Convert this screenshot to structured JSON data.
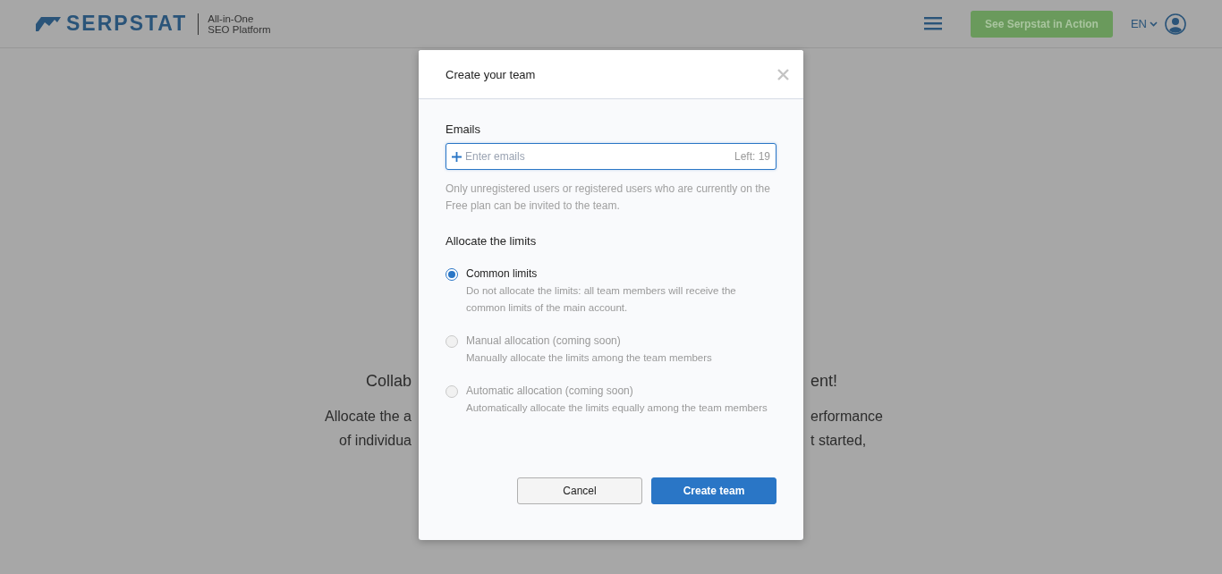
{
  "header": {
    "logo": {
      "name": "SERPSTAT",
      "tagline_line_1": "All-in-One",
      "tagline_line_2": "SEO Platform"
    },
    "cta_button": "See Serpstat in Action",
    "language": "EN"
  },
  "background": {
    "heading_left": "Collab",
    "heading_right": "ent!",
    "lines": [
      {
        "left": "Allocate the a",
        "right": "erformance"
      },
      {
        "left": "of individua",
        "right": "t started,"
      }
    ]
  },
  "dialog": {
    "title": "Create your team",
    "emails_label": "Emails",
    "emails_field": {
      "placeholder": "Enter emails",
      "counter": "Left: 19"
    },
    "note": "Only unregistered users or registered users who are currently on the Free plan can be invited to the team.",
    "limits_label": "Allocate the limits",
    "options": [
      {
        "title": "Common limits",
        "description": "Do not allocate the limits: all team members will receive the common limits of the main account.",
        "selected": true,
        "disabled": false
      },
      {
        "title": "Manual allocation (coming soon)",
        "description": "Manually allocate the limits among the team members",
        "selected": false,
        "disabled": true
      },
      {
        "title": "Automatic allocation (coming soon)",
        "description": "Automatically allocate the limits equally among the team members",
        "selected": false,
        "disabled": true
      }
    ],
    "buttons": [
      {
        "label": "Cancel",
        "kind": "secondary"
      },
      {
        "label": "Create team",
        "kind": "primary"
      }
    ]
  }
}
